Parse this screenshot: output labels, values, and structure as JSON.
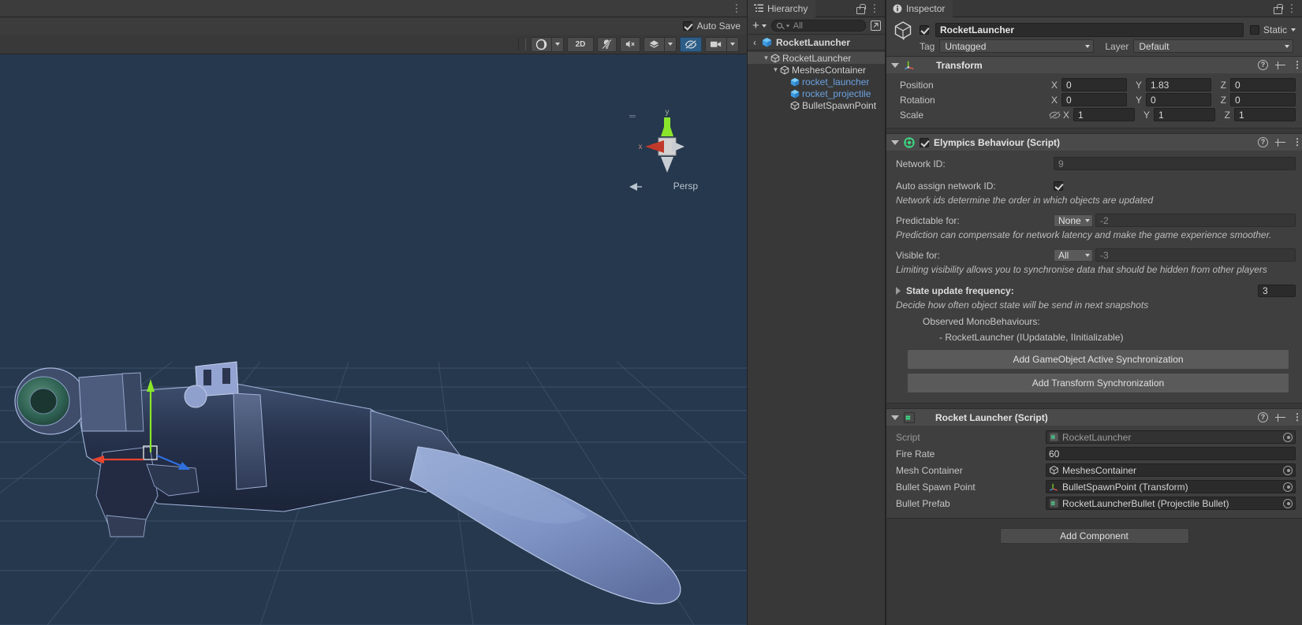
{
  "window": {
    "scene_panel_menu_icon": "kebab-menu-icon",
    "auto_save_label": "Auto Save",
    "auto_save_checked": true
  },
  "scene_toolbar": {
    "buttons": [
      {
        "name": "scene-lighting-dropdown",
        "label": "",
        "icon": "shaded-sphere-icon",
        "has_caret": true,
        "active": false
      },
      {
        "name": "toggle-2d-button",
        "label": "2D",
        "icon": "",
        "has_caret": false,
        "active": false
      },
      {
        "name": "scene-lighting-toggle",
        "label": "",
        "icon": "light-bulb-icon",
        "has_caret": false,
        "active": false
      },
      {
        "name": "scene-audio-toggle",
        "label": "",
        "icon": "audio-mute-icon",
        "has_caret": false,
        "active": false
      },
      {
        "name": "scene-fx-dropdown",
        "label": "",
        "icon": "fx-layers-icon",
        "has_caret": true,
        "active": false
      },
      {
        "name": "scene-visibility-toggle",
        "label": "",
        "icon": "eye-off-icon",
        "has_caret": false,
        "active": true
      },
      {
        "name": "scene-camera-dropdown",
        "label": "",
        "icon": "camera-icon",
        "has_caret": true,
        "active": false
      }
    ]
  },
  "scene_view": {
    "gizmo": {
      "axis_x_label": "x",
      "axis_y_label": "y",
      "projection_label": "Persp",
      "axis_x_color": "#c1392b",
      "axis_y_color": "#7ed321",
      "axis_z_color": "#3a7bd5"
    },
    "background_color": "#26384d",
    "grid_color": "#3e5570",
    "handle_colors": {
      "x": "#e9442f",
      "y": "#8ae62a",
      "z": "#2f6fe0",
      "center": "#d8d8d8"
    }
  },
  "hierarchy": {
    "tab_label": "Hierarchy",
    "tab_icon": "hierarchy-icon",
    "lock_icon": "lock-icon",
    "menu_icon": "kebab-menu-icon",
    "add_label": "+",
    "search_placeholder": "All",
    "search_value": "",
    "breadcrumb_label": "RocketLauncher",
    "tree": [
      {
        "label": "RocketLauncher",
        "depth": 0,
        "expanded": true,
        "icon": "gameobject-icon",
        "selected": true,
        "prefab": false
      },
      {
        "label": "MeshesContainer",
        "depth": 1,
        "expanded": true,
        "icon": "gameobject-icon",
        "selected": false,
        "prefab": false
      },
      {
        "label": "rocket_launcher",
        "depth": 2,
        "expanded": false,
        "icon": "prefab-icon",
        "selected": false,
        "prefab": true
      },
      {
        "label": "rocket_projectile",
        "depth": 2,
        "expanded": false,
        "icon": "prefab-icon",
        "selected": false,
        "prefab": true
      },
      {
        "label": "BulletSpawnPoint",
        "depth": 2,
        "expanded": false,
        "icon": "gameobject-icon",
        "selected": false,
        "prefab": false
      }
    ]
  },
  "inspector": {
    "tab_label": "Inspector",
    "tab_icon": "info-icon",
    "lock_icon": "lock-icon",
    "menu_icon": "kebab-menu-icon",
    "object": {
      "icon": "gameobject-icon",
      "enabled": true,
      "name": "RocketLauncher",
      "static_label": "Static",
      "static_checked": false,
      "tag_label": "Tag",
      "tag_value": "Untagged",
      "layer_label": "Layer",
      "layer_value": "Default"
    },
    "transform": {
      "title": "Transform",
      "icon": "transform-icon",
      "rows": [
        {
          "label": "Position",
          "x": "0",
          "y": "1.83",
          "z": "0",
          "eye": false
        },
        {
          "label": "Rotation",
          "x": "0",
          "y": "0",
          "z": "0",
          "eye": false
        },
        {
          "label": "Scale",
          "x": "1",
          "y": "1",
          "z": "1",
          "eye": true
        }
      ],
      "axis_labels": {
        "x": "X",
        "y": "Y",
        "z": "Z"
      }
    },
    "elympics": {
      "title": "Elympics Behaviour (Script)",
      "icon": "elympics-icon",
      "enabled": true,
      "network_id_label": "Network ID:",
      "network_id_value": "9",
      "auto_assign_label": "Auto assign network ID:",
      "auto_assign_checked": true,
      "auto_assign_hint": "Network ids determine the order in which objects are updated",
      "predictable_label": "Predictable for:",
      "predictable_value": "None",
      "predictable_num": "-2",
      "predictable_hint": "Prediction can compensate for network latency and make the game experience smoother.",
      "visible_label": "Visible for:",
      "visible_value": "All",
      "visible_num": "-3",
      "visible_hint": "Limiting visibility allows you to synchronise data that should be hidden from other players",
      "state_freq_label": "State update frequency:",
      "state_freq_value": "3",
      "state_freq_hint": "Decide how often object state will be send in next snapshots",
      "observed_label": "Observed MonoBehaviours:",
      "observed_items": [
        "- RocketLauncher (IUpdatable, IInitializable)"
      ],
      "btn_add_active_sync": "Add GameObject Active Synchronization",
      "btn_add_transform_sync": "Add Transform Synchronization"
    },
    "rocket_launcher": {
      "title": "Rocket Launcher (Script)",
      "icon": "csharp-script-icon",
      "rows": [
        {
          "label": "Script",
          "value": "RocketLauncher",
          "icon": "csharp-script-icon",
          "readonly": true,
          "type": "object"
        },
        {
          "label": "Fire Rate",
          "value": "60",
          "icon": "",
          "readonly": false,
          "type": "number"
        },
        {
          "label": "Mesh Container",
          "value": "MeshesContainer",
          "icon": "gameobject-icon",
          "readonly": false,
          "type": "object"
        },
        {
          "label": "Bullet Spawn Point",
          "value": "BulletSpawnPoint (Transform)",
          "icon": "transform-icon",
          "readonly": false,
          "type": "object"
        },
        {
          "label": "Bullet Prefab",
          "value": "RocketLauncherBullet (Projectile Bullet)",
          "icon": "csharp-script-icon",
          "readonly": false,
          "type": "object"
        }
      ]
    },
    "add_component_label": "Add Component"
  }
}
